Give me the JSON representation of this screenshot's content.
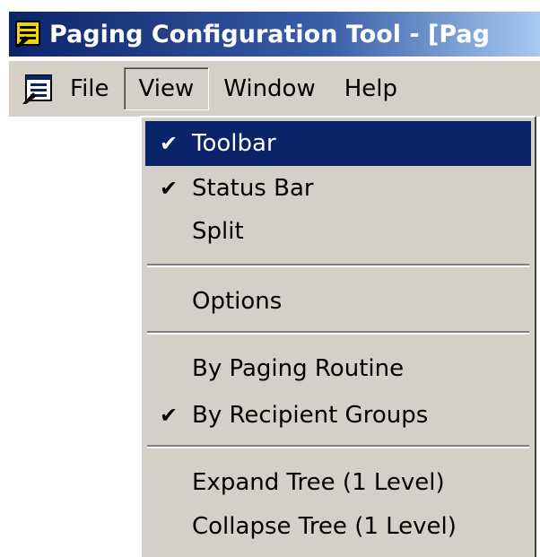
{
  "window": {
    "title": "Paging Configuration Tool - [Pag"
  },
  "menubar": {
    "items": [
      {
        "label": "File"
      },
      {
        "label": "View"
      },
      {
        "label": "Window"
      },
      {
        "label": "Help"
      }
    ]
  },
  "view_menu": {
    "check_glyph": "✔",
    "items": [
      {
        "label": "Toolbar",
        "checked": true,
        "highlighted": true
      },
      {
        "label": "Status Bar",
        "checked": true
      },
      {
        "label": "Split",
        "checked": false
      },
      {
        "label": "Options",
        "checked": false
      },
      {
        "label": "By Paging Routine",
        "checked": false
      },
      {
        "label": "By Recipient Groups",
        "checked": true
      },
      {
        "label": "Expand Tree (1 Level)",
        "checked": false
      },
      {
        "label": "Collapse Tree (1 Level)",
        "checked": false
      }
    ]
  },
  "colors": {
    "title_bar": "#0a246a",
    "highlight": "#0a246a",
    "menu_face": "#d4d0c8"
  }
}
